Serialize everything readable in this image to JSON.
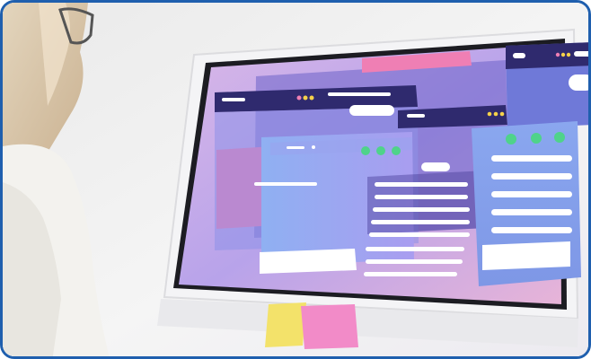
{
  "image": {
    "subject": "photo-illustration",
    "frame_color": "#1f5fae"
  },
  "palette": {
    "screen_bg": "#b9a6e6",
    "pink": "#ec7fb3",
    "navy": "#2f2a6e",
    "blue": "#7b9ff0",
    "green_dot": "#4fd38a",
    "yellow_dot": "#f6d24a",
    "sticky_yellow": "#f3e26a",
    "sticky_pink": "#f28bc8"
  },
  "icons": [
    "window-dots-icon",
    "window-dots-icon",
    "window-dots-icon"
  ]
}
